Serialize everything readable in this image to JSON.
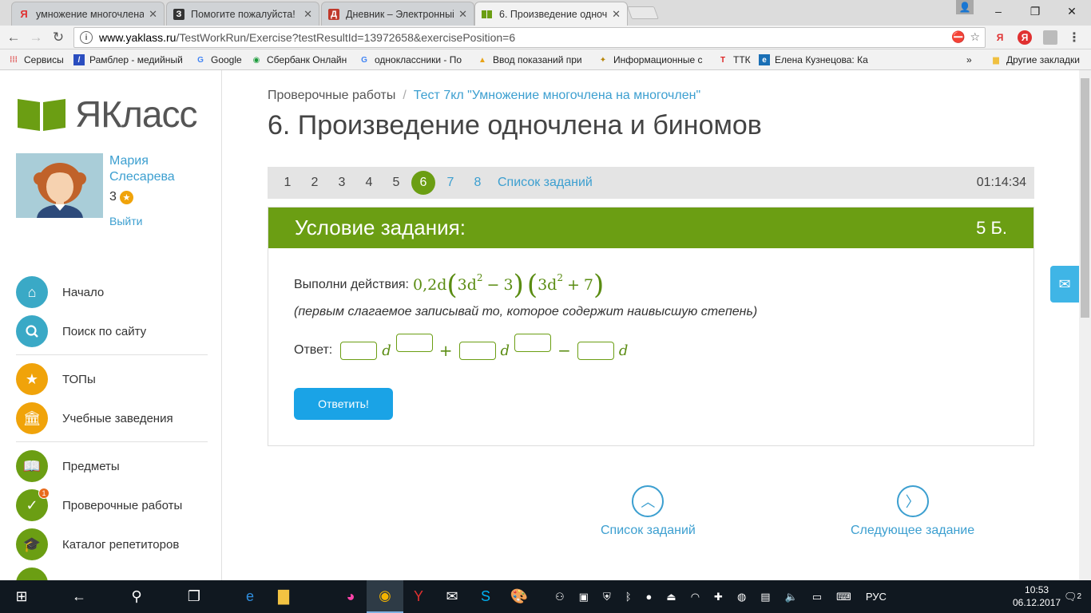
{
  "browser": {
    "tabs": [
      {
        "title": "умножение многочлена",
        "icon": "Я",
        "active": false
      },
      {
        "title": "Помогите пожалуйста!",
        "icon": "З",
        "active": false
      },
      {
        "title": "Дневник – Электронный",
        "icon": "Д",
        "active": false
      },
      {
        "title": "6. Произведение одноч",
        "icon": "Я",
        "active": true
      }
    ],
    "window_controls": {
      "minimize": "–",
      "restore": "❐",
      "close": "✕"
    },
    "url_domain": "www.yaklass.ru",
    "url_path": "/TestWorkRun/Exercise?testResultId=13972658&exercisePosition=6",
    "bookmarks": [
      {
        "label": "Сервисы",
        "icon": "grid-icon"
      },
      {
        "label": "Рамблер - медийный",
        "icon": "rambler-icon"
      },
      {
        "label": "Google",
        "icon": "google-icon"
      },
      {
        "label": "Сбербанк Онлайн",
        "icon": "sberbank-icon"
      },
      {
        "label": "одноклассники - По",
        "icon": "google-icon"
      },
      {
        "label": "Ввод показаний при",
        "icon": "meter-icon"
      },
      {
        "label": "Информационные с",
        "icon": "emblem-icon"
      },
      {
        "label": "ТТК",
        "icon": "ttk-icon"
      },
      {
        "label": "Елена Кузнецова: Ка",
        "icon": "ie-icon"
      }
    ],
    "bookmarks_more": "»",
    "other_bookmarks": "Другие закладки"
  },
  "sidebar": {
    "logo_text": "ЯКласс",
    "user_first": "Мария",
    "user_last": "Слесарева",
    "score": "3",
    "logout": "Выйти",
    "menu": [
      {
        "label": "Начало",
        "icon": "home-icon",
        "color": "#3aa9c6"
      },
      {
        "label": "Поиск по сайту",
        "icon": "search-icon",
        "color": "#3aa9c6"
      },
      {
        "label": "ТОПы",
        "icon": "star-icon",
        "color": "#f0a30a"
      },
      {
        "label": "Учебные заведения",
        "icon": "school-icon",
        "color": "#f0a30a"
      },
      {
        "label": "Предметы",
        "icon": "book-icon",
        "color": "#6b9e13"
      },
      {
        "label": "Проверочные работы",
        "icon": "check-icon",
        "color": "#6b9e13",
        "badge": "1"
      },
      {
        "label": "Каталог репетиторов",
        "icon": "graduation-cap-icon",
        "color": "#6b9e13"
      }
    ]
  },
  "main": {
    "breadcrumb_root": "Проверочные работы",
    "breadcrumb_sep": "/",
    "breadcrumb_test": "Тест 7кл \"Умножение многочлена на многочлен\"",
    "title": "6. Произведение одночлена и биномов",
    "task_numbers": [
      "1",
      "2",
      "3",
      "4",
      "5",
      "6",
      "7",
      "8"
    ],
    "current_task": "6",
    "task_list_link": "Список заданий",
    "timer": "01:14:34",
    "condition_header": "Условие задания:",
    "points": "5 Б.",
    "instruction": "Выполни действия:",
    "expr": {
      "coef": "0,2d",
      "a1": "3d",
      "e1": "2",
      "op1": "−",
      "b1": "3",
      "a2": "3d",
      "e2": "2",
      "op2": "+",
      "b2": "7"
    },
    "hint": "(первым слагаемое записывай то, которое содержит наивысшую степень)",
    "answer_label": "Ответ:",
    "answer_var": "d",
    "answer_op1": "+",
    "answer_op2": "−",
    "submit": "Ответить!",
    "nav_list": "Список заданий",
    "nav_next": "Следующее задание"
  },
  "taskbar": {
    "language": "РУС",
    "time": "10:53",
    "date": "06.12.2017",
    "notifications": "2"
  }
}
